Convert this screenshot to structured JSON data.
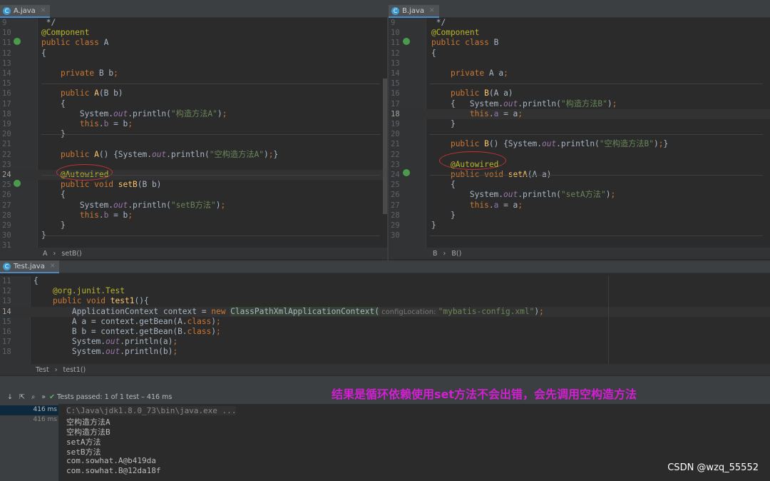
{
  "tabs": {
    "a": "A.java",
    "b": "B.java",
    "test": "Test.java"
  },
  "paneA": {
    "start": 9,
    "current": 24,
    "lines": [
      [
        [
          "t",
          " */"
        ]
      ],
      [
        [
          "a",
          "@Component"
        ]
      ],
      [
        [
          "k",
          "public class "
        ],
        [
          "t",
          "A"
        ]
      ],
      [
        [
          "t",
          "{"
        ]
      ],
      [],
      [
        [
          "t",
          "    "
        ],
        [
          "k",
          "private "
        ],
        [
          "t",
          "B b"
        ],
        [
          "k",
          ";"
        ]
      ],
      [],
      [
        [
          "t",
          "    "
        ],
        [
          "k",
          "public "
        ],
        [
          "m",
          "A"
        ],
        [
          "t",
          "(B b)"
        ]
      ],
      [
        [
          "t",
          "    {"
        ]
      ],
      [
        [
          "t",
          "        System."
        ],
        [
          "o",
          "out"
        ],
        [
          "t",
          ".println("
        ],
        [
          "s",
          "\"构造方法A\""
        ],
        [
          "t",
          ")"
        ],
        [
          "k",
          ";"
        ]
      ],
      [
        [
          "t",
          "        "
        ],
        [
          "k",
          "this"
        ],
        [
          "t",
          "."
        ],
        [
          "f",
          "b"
        ],
        [
          "t",
          " = b"
        ],
        [
          "k",
          ";"
        ]
      ],
      [
        [
          "t",
          "    }"
        ]
      ],
      [],
      [
        [
          "t",
          "    "
        ],
        [
          "k",
          "public "
        ],
        [
          "m",
          "A"
        ],
        [
          "t",
          "() {System."
        ],
        [
          "o",
          "out"
        ],
        [
          "t",
          ".println("
        ],
        [
          "s",
          "\"空构造方法A\""
        ],
        [
          "t",
          ")"
        ],
        [
          "k",
          ";"
        ],
        [
          "t",
          "}"
        ]
      ],
      [],
      [
        [
          "t",
          "    "
        ],
        [
          "a",
          "@Autowired"
        ]
      ],
      [
        [
          "t",
          "    "
        ],
        [
          "k",
          "public void "
        ],
        [
          "m",
          "setB"
        ],
        [
          "t",
          "(B b)"
        ]
      ],
      [
        [
          "t",
          "    {"
        ]
      ],
      [
        [
          "t",
          "        System."
        ],
        [
          "o",
          "out"
        ],
        [
          "t",
          ".println("
        ],
        [
          "s",
          "\"setB方法\""
        ],
        [
          "t",
          ")"
        ],
        [
          "k",
          ";"
        ]
      ],
      [
        [
          "t",
          "        "
        ],
        [
          "k",
          "this"
        ],
        [
          "t",
          "."
        ],
        [
          "f",
          "b"
        ],
        [
          "t",
          " = b"
        ],
        [
          "k",
          ";"
        ]
      ],
      [
        [
          "t",
          "    }"
        ]
      ],
      [
        [
          "t",
          "}"
        ]
      ],
      []
    ],
    "crumb": [
      "A",
      "setB()"
    ]
  },
  "paneB": {
    "start": 9,
    "current": 18,
    "lines": [
      [
        [
          "t",
          " */"
        ]
      ],
      [
        [
          "a",
          "@Component"
        ]
      ],
      [
        [
          "k",
          "public class "
        ],
        [
          "t",
          "B"
        ]
      ],
      [
        [
          "t",
          "{"
        ]
      ],
      [],
      [
        [
          "t",
          "    "
        ],
        [
          "k",
          "private "
        ],
        [
          "t",
          "A a"
        ],
        [
          "k",
          ";"
        ]
      ],
      [],
      [
        [
          "t",
          "    "
        ],
        [
          "k",
          "public "
        ],
        [
          "m",
          "B"
        ],
        [
          "t",
          "(A a)"
        ]
      ],
      [
        [
          "t",
          "    {   System."
        ],
        [
          "o",
          "out"
        ],
        [
          "t",
          ".println("
        ],
        [
          "s",
          "\"构造方法B\""
        ],
        [
          "t",
          ")"
        ],
        [
          "k",
          ";"
        ]
      ],
      [
        [
          "t",
          "        "
        ],
        [
          "k",
          "this"
        ],
        [
          "t",
          "."
        ],
        [
          "f",
          "a"
        ],
        [
          "t",
          " = a"
        ],
        [
          "k",
          ";"
        ]
      ],
      [
        [
          "t",
          "    }"
        ]
      ],
      [],
      [
        [
          "t",
          "    "
        ],
        [
          "k",
          "public "
        ],
        [
          "m",
          "B"
        ],
        [
          "t",
          "() {System."
        ],
        [
          "o",
          "out"
        ],
        [
          "t",
          ".println("
        ],
        [
          "s",
          "\"空构造方法B\""
        ],
        [
          "t",
          ")"
        ],
        [
          "k",
          ";"
        ],
        [
          "t",
          "}"
        ]
      ],
      [],
      [
        [
          "t",
          "    "
        ],
        [
          "a",
          "@Autowired"
        ]
      ],
      [
        [
          "t",
          "    "
        ],
        [
          "k",
          "public void "
        ],
        [
          "m",
          "setA"
        ],
        [
          "t",
          "(A a)"
        ]
      ],
      [
        [
          "t",
          "    {"
        ]
      ],
      [
        [
          "t",
          "        System."
        ],
        [
          "o",
          "out"
        ],
        [
          "t",
          ".println("
        ],
        [
          "s",
          "\"setA方法\""
        ],
        [
          "t",
          ")"
        ],
        [
          "k",
          ";"
        ]
      ],
      [
        [
          "t",
          "        "
        ],
        [
          "k",
          "this"
        ],
        [
          "t",
          "."
        ],
        [
          "f",
          "a"
        ],
        [
          "t",
          " = a"
        ],
        [
          "k",
          ";"
        ]
      ],
      [
        [
          "t",
          "    }"
        ]
      ],
      [
        [
          "t",
          "}"
        ]
      ],
      []
    ],
    "crumb": [
      "B",
      "B()"
    ]
  },
  "paneTest": {
    "start": 11,
    "current": 14,
    "lines": [
      [
        [
          "t",
          "{"
        ]
      ],
      [
        [
          "t",
          "    "
        ],
        [
          "a",
          "@org.junit.Test"
        ]
      ],
      [
        [
          "t",
          "    "
        ],
        [
          "k",
          "public void "
        ],
        [
          "m",
          "test1"
        ],
        [
          "t",
          "(){"
        ]
      ],
      [
        [
          "t",
          "        ApplicationContext context = "
        ],
        [
          "k",
          "new "
        ],
        [
          "hl",
          "ClassPathXmlApplicationContext("
        ],
        [
          "h",
          " configLocation: "
        ],
        [
          "s",
          "\"mybatis-config.xml\""
        ],
        [
          "t",
          ")"
        ],
        [
          "k",
          ";"
        ]
      ],
      [
        [
          "t",
          "        A a = context.getBean(A."
        ],
        [
          "k",
          "class"
        ],
        [
          "t",
          ")"
        ],
        [
          "k",
          ";"
        ]
      ],
      [
        [
          "t",
          "        B b = context.getBean(B."
        ],
        [
          "k",
          "class"
        ],
        [
          "t",
          ")"
        ],
        [
          "k",
          ";"
        ]
      ],
      [
        [
          "t",
          "        System."
        ],
        [
          "o",
          "out"
        ],
        [
          "t",
          ".println(a)"
        ],
        [
          "k",
          ";"
        ]
      ],
      [
        [
          "t",
          "        System."
        ],
        [
          "o",
          "out"
        ],
        [
          "t",
          ".println(b)"
        ],
        [
          "k",
          ";"
        ]
      ]
    ],
    "crumb": [
      "Test",
      "test1()"
    ]
  },
  "run": {
    "status": "Tests passed:",
    "detail": "1 of 1 test – 416 ms",
    "times": [
      "416 ms",
      "416 ms"
    ]
  },
  "console": [
    "C:\\Java\\jdk1.8.0_73\\bin\\java.exe ...",
    "空构造方法A",
    "空构造方法B",
    "setA方法",
    "setB方法",
    "com.sowhat.A@b419da",
    "com.sowhat.B@12da18f"
  ],
  "annotation": "结果是循环依赖使用set方法不会出错，会先调用空构造方法",
  "watermark": "CSDN @wzq_55552",
  "colors": {
    "keyword": "#cc7832",
    "annotation": "#bbb529",
    "string": "#6a8759",
    "field": "#9876aa",
    "note": "#d21fd2"
  }
}
